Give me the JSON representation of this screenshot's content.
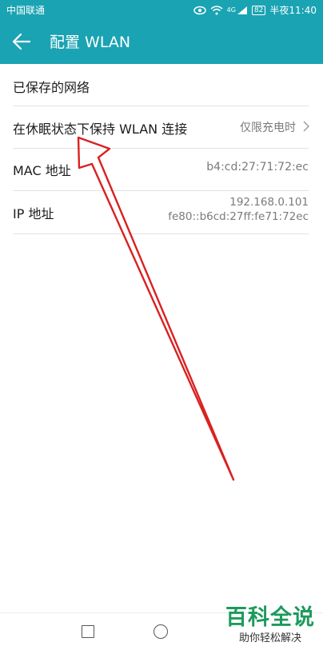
{
  "status_bar": {
    "carrier": "中国联通",
    "network_badge": "4G",
    "battery": "82",
    "time": "半夜11:40",
    "icons": [
      "eye-icon",
      "wifi-icon",
      "signal-icon",
      "battery-icon"
    ]
  },
  "app_bar": {
    "title": "配置 WLAN",
    "back_icon": "back-arrow-icon"
  },
  "settings": {
    "saved_networks": "已保存的网络",
    "keep_wlan": {
      "label": "在休眠状态下保持 WLAN 连接",
      "value": "仅限充电时"
    },
    "mac": {
      "label": "MAC 地址",
      "value": "b4:cd:27:71:72:ec"
    },
    "ip": {
      "label": "IP 地址",
      "ipv4": "192.168.0.101",
      "ipv6": "fe80::b6cd:27ff:fe71:72ec"
    }
  },
  "annotation": {
    "color": "#d92121"
  },
  "watermark": {
    "main": "百科全说",
    "sub": "助你轻松解决"
  },
  "colors": {
    "accent": "#1aa3b3"
  }
}
